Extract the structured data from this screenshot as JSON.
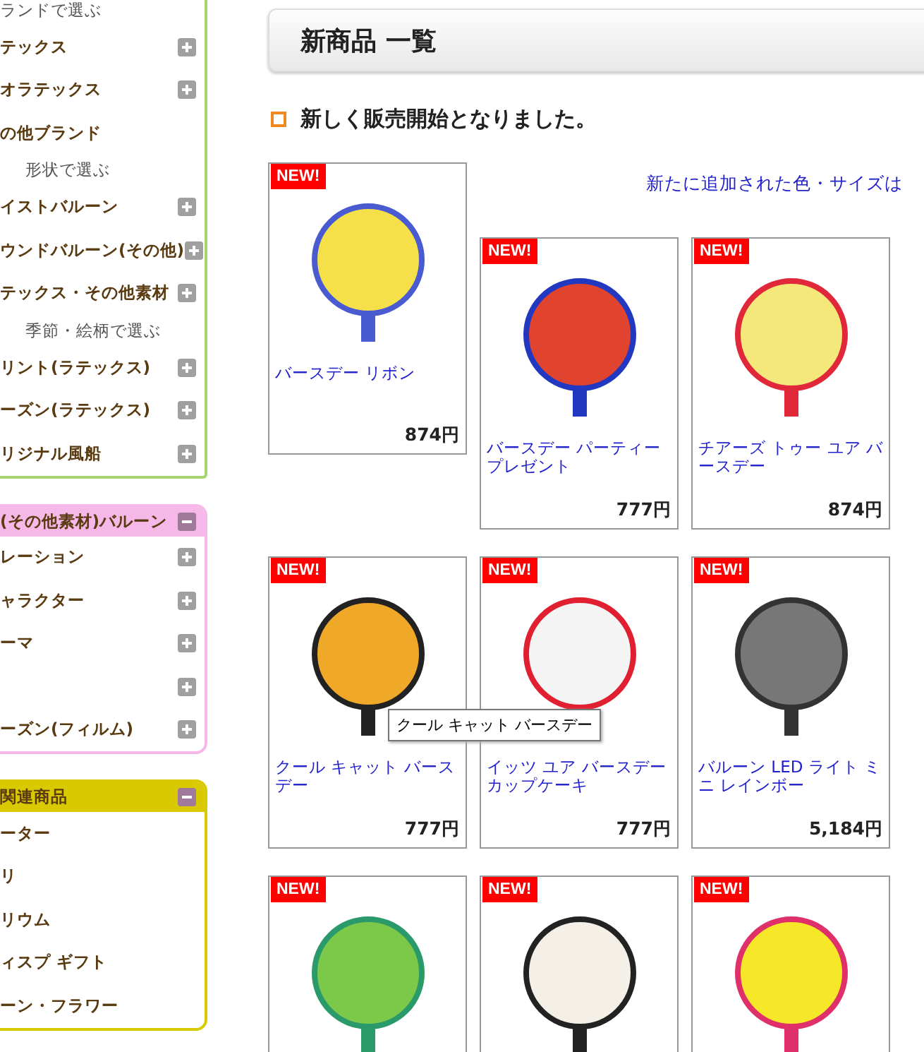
{
  "sidebar": {
    "sections": [
      {
        "color": "#a8d46f",
        "items": [
          {
            "kind": "sub",
            "label": "ランドで選ぶ"
          },
          {
            "kind": "item",
            "label": "テックス",
            "expanded": false
          },
          {
            "kind": "item",
            "label": "オラテックス",
            "expanded": false
          },
          {
            "kind": "plain",
            "label": "の他ブランド"
          },
          {
            "kind": "sub",
            "label": "形状で選ぶ"
          },
          {
            "kind": "item",
            "label": "イストバルーン",
            "expanded": false
          },
          {
            "kind": "item",
            "label": "ウンドバルーン(その他)",
            "expanded": false
          },
          {
            "kind": "item",
            "label": "テックス・その他素材",
            "expanded": false
          },
          {
            "kind": "sub",
            "label": "季節・絵柄で選ぶ"
          },
          {
            "kind": "item",
            "label": "リント(ラテックス)",
            "expanded": false
          },
          {
            "kind": "item",
            "label": "ーズン(ラテックス)",
            "expanded": false
          },
          {
            "kind": "item",
            "label": "リジナル風船",
            "expanded": false
          }
        ]
      },
      {
        "heading": "(その他素材)バルーン",
        "color": "#f5b8e8",
        "expanded": true,
        "items": [
          {
            "kind": "item",
            "label": "レーション",
            "expanded": false
          },
          {
            "kind": "item",
            "label": "ャラクター",
            "expanded": false
          },
          {
            "kind": "item",
            "label": "ーマ",
            "expanded": false
          },
          {
            "kind": "item",
            "expanded": false
          },
          {
            "kind": "item",
            "label": "ーズン(フィルム)",
            "expanded": false
          }
        ]
      },
      {
        "heading": "関連商品",
        "color": "#d9c900",
        "expanded": true,
        "items": [
          {
            "kind": "plain",
            "label": "ーター"
          },
          {
            "kind": "plain",
            "label": "リ"
          },
          {
            "kind": "plain",
            "label": "リウム"
          },
          {
            "kind": "plain",
            "label": "ィスプ ギフト"
          },
          {
            "kind": "plain",
            "label": "ーン・フラワー"
          }
        ]
      }
    ]
  },
  "main": {
    "title": "新商品 一覧",
    "intro": "新しく販売開始となりました。",
    "notice_link": "新たに追加された色・サイズは",
    "products": [
      {
        "badge": "NEW!",
        "name": "バースデー リボン",
        "price": "874円"
      },
      {
        "badge": "NEW!",
        "name": "バースデー パーティープレゼント",
        "price": "777円"
      },
      {
        "badge": "NEW!",
        "name": "チアーズ トゥー ユア バースデー",
        "price": "874円"
      },
      {
        "badge": "NEW!",
        "name": "クール キャット バースデー",
        "price": "777円",
        "tooltip": "クール キャット バースデー"
      },
      {
        "badge": "NEW!",
        "name": "イッツ ユア バースデーカップケーキ",
        "price": "777円"
      },
      {
        "badge": "NEW!",
        "name": "バルーン LED ライト ミニ レインボー",
        "price": "5,184円"
      },
      {
        "badge": "NEW!"
      },
      {
        "badge": "NEW!"
      },
      {
        "badge": "NEW!"
      }
    ]
  }
}
